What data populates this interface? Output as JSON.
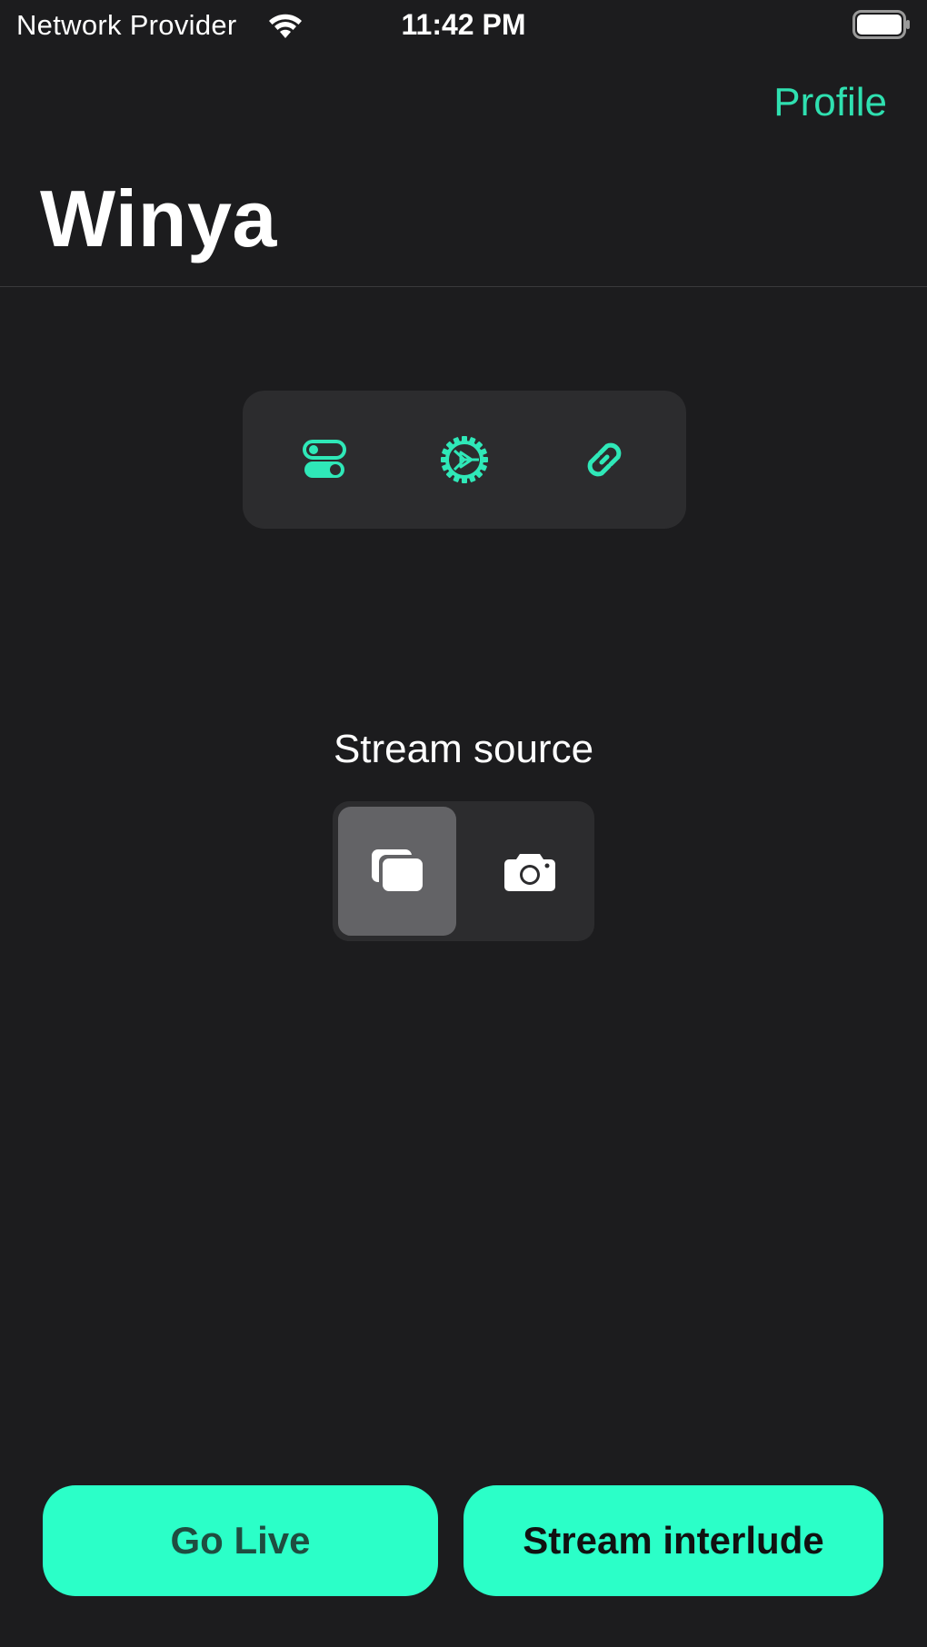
{
  "status_bar": {
    "carrier": "Network Provider",
    "time": "11:42 PM"
  },
  "nav": {
    "profile_label": "Profile",
    "title": "Winya"
  },
  "toolbar": {
    "items": [
      {
        "icon": "toggles-icon"
      },
      {
        "icon": "gear-play-icon"
      },
      {
        "icon": "link-icon"
      }
    ]
  },
  "stream_source": {
    "label": "Stream source",
    "options": [
      {
        "icon": "screens-icon",
        "selected": true
      },
      {
        "icon": "camera-icon",
        "selected": false
      }
    ]
  },
  "actions": {
    "go_live_label": "Go Live",
    "interlude_label": "Stream interlude"
  },
  "colors": {
    "background": "#1c1c1e",
    "accent": "#2bffc8",
    "accent_text": "#2fe0b0",
    "card": "#2c2c2e"
  }
}
